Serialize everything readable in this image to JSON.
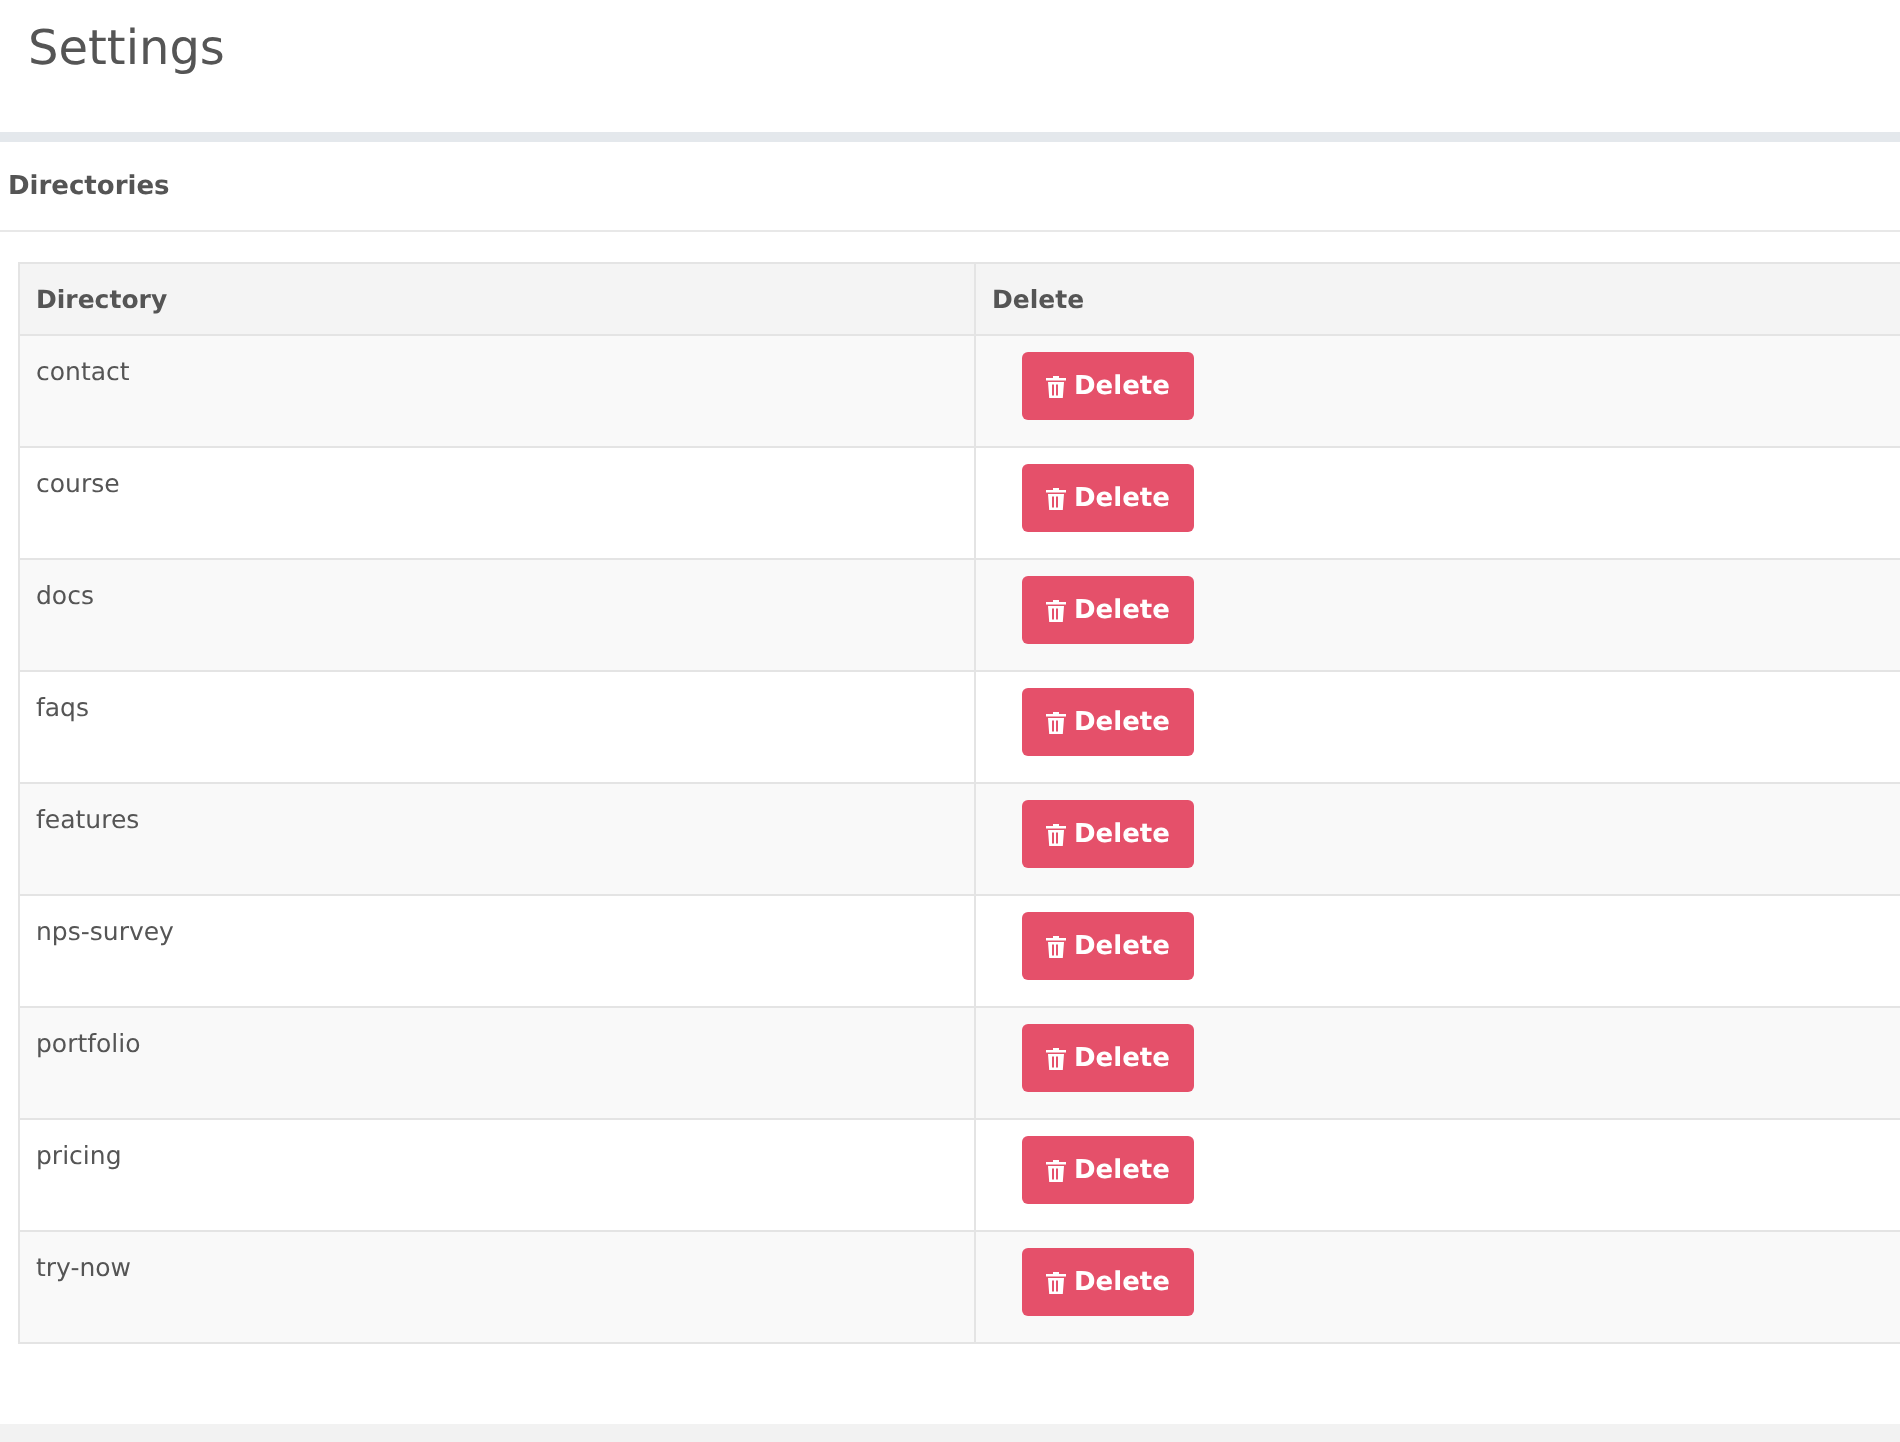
{
  "page": {
    "title": "Settings"
  },
  "panel": {
    "heading": "Directories"
  },
  "table": {
    "columns": [
      "Directory",
      "Delete"
    ],
    "rows": [
      {
        "directory": "contact",
        "action": "Delete"
      },
      {
        "directory": "course",
        "action": "Delete"
      },
      {
        "directory": "docs",
        "action": "Delete"
      },
      {
        "directory": "faqs",
        "action": "Delete"
      },
      {
        "directory": "features",
        "action": "Delete"
      },
      {
        "directory": "nps-survey",
        "action": "Delete"
      },
      {
        "directory": "portfolio",
        "action": "Delete"
      },
      {
        "directory": "pricing",
        "action": "Delete"
      },
      {
        "directory": "try-now",
        "action": "Delete"
      }
    ]
  }
}
